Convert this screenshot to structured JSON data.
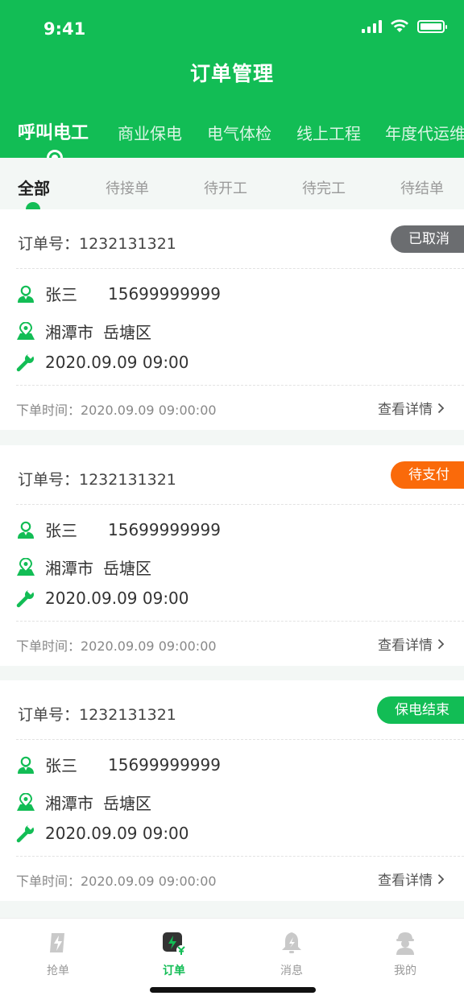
{
  "status_bar": {
    "time": "9:41"
  },
  "header": {
    "title": "订单管理"
  },
  "category_tabs": [
    "呼叫电工",
    "商业保电",
    "电气体检",
    "线上工程",
    "年度代运维"
  ],
  "status_tabs": [
    "全部",
    "待接单",
    "待开工",
    "待完工",
    "待结单"
  ],
  "orders": [
    {
      "order_label": "订单号：1232131321",
      "status": "已取消",
      "status_color": "#6b6d70",
      "name": "张三",
      "phone": "15699999999",
      "city": "湘潭市",
      "district": "岳塘区",
      "service_time": "2020.09.09 09:00",
      "created": "下单时间：2020.09.09 09:00:00",
      "detail_label": "查看详情"
    },
    {
      "order_label": "订单号：1232131321",
      "status": "待支付",
      "status_color": "#fa6a0a",
      "name": "张三",
      "phone": "15699999999",
      "city": "湘潭市",
      "district": "岳塘区",
      "service_time": "2020.09.09 09:00",
      "created": "下单时间：2020.09.09 09:00:00",
      "detail_label": "查看详情"
    },
    {
      "order_label": "订单号：1232131321",
      "status": "保电结束",
      "status_color": "#12bd55",
      "name": "张三",
      "phone": "15699999999",
      "city": "湘潭市",
      "district": "岳塘区",
      "service_time": "2020.09.09 09:00",
      "created": "下单时间：2020.09.09 09:00:00",
      "detail_label": "查看详情"
    }
  ],
  "tabbar": [
    {
      "label": "抢单",
      "icon": "grab-order-icon"
    },
    {
      "label": "订单",
      "icon": "orders-icon"
    },
    {
      "label": "消息",
      "icon": "bell-icon"
    },
    {
      "label": "我的",
      "icon": "worker-avatar-icon"
    }
  ],
  "colors": {
    "brand": "#12bd55",
    "inactive": "#999999"
  }
}
